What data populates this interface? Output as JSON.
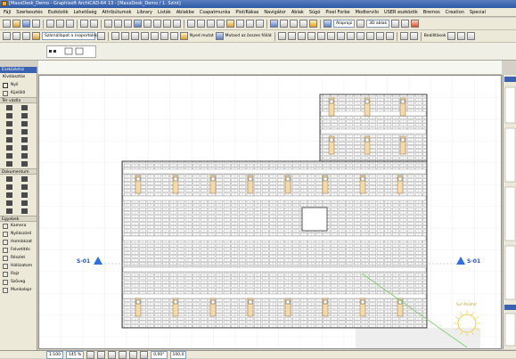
{
  "window": {
    "title": "[MaxxDesk_Demo - Graphisoft ArchiCAD-64 13 - [MaxxDesk_Demo / 1. Szint]"
  },
  "menu": [
    "Fájl",
    "Szerkesztés",
    "Eszközök",
    "Lehetőség",
    "Attribútumok",
    "Library",
    "Listák",
    "Ablakbe",
    "Csapatmunka",
    "Plot/Rákas",
    "Navigátor",
    "Ablak",
    "Súgó",
    "Pixel Forbe",
    "Modtervilo",
    "USER eszközök",
    "Bremos",
    "Creation",
    "Special"
  ],
  "toolbar2": {
    "layer_field": "Szárnállapot a csoportokkal",
    "nyed_label": "Nyed mutat",
    "mutasd_label": "Mutasd az összes fóliát",
    "alaprajz_label": "Alaprajz",
    "view3d_label": "3D ablak",
    "beallitasok_label": "Beállítások"
  },
  "toolbox": {
    "header": "Eszközkész",
    "kivalasztas": "Kiválasztás",
    "nyil": "Nyíl",
    "kijeloles": "Kijelölő",
    "terv_section": "Tér vázlla",
    "dok_section": "Dokumentum",
    "egyeb_section": "Egyebek",
    "items": [
      "Kamera",
      "Nyílászáró",
      "Homlokzat",
      "Felvetítés",
      "Részlet",
      "Hálózatom",
      "Rajz",
      "Szöveg",
      "Munkalapr"
    ]
  },
  "canvas": {
    "section_marker_left": "S-01",
    "section_marker_right": "S-01",
    "sun_label": "Sun Pointer"
  },
  "status": {
    "scale": "1:100",
    "zoom": "145 %",
    "angle": "0,00°",
    "value": "100,0"
  }
}
